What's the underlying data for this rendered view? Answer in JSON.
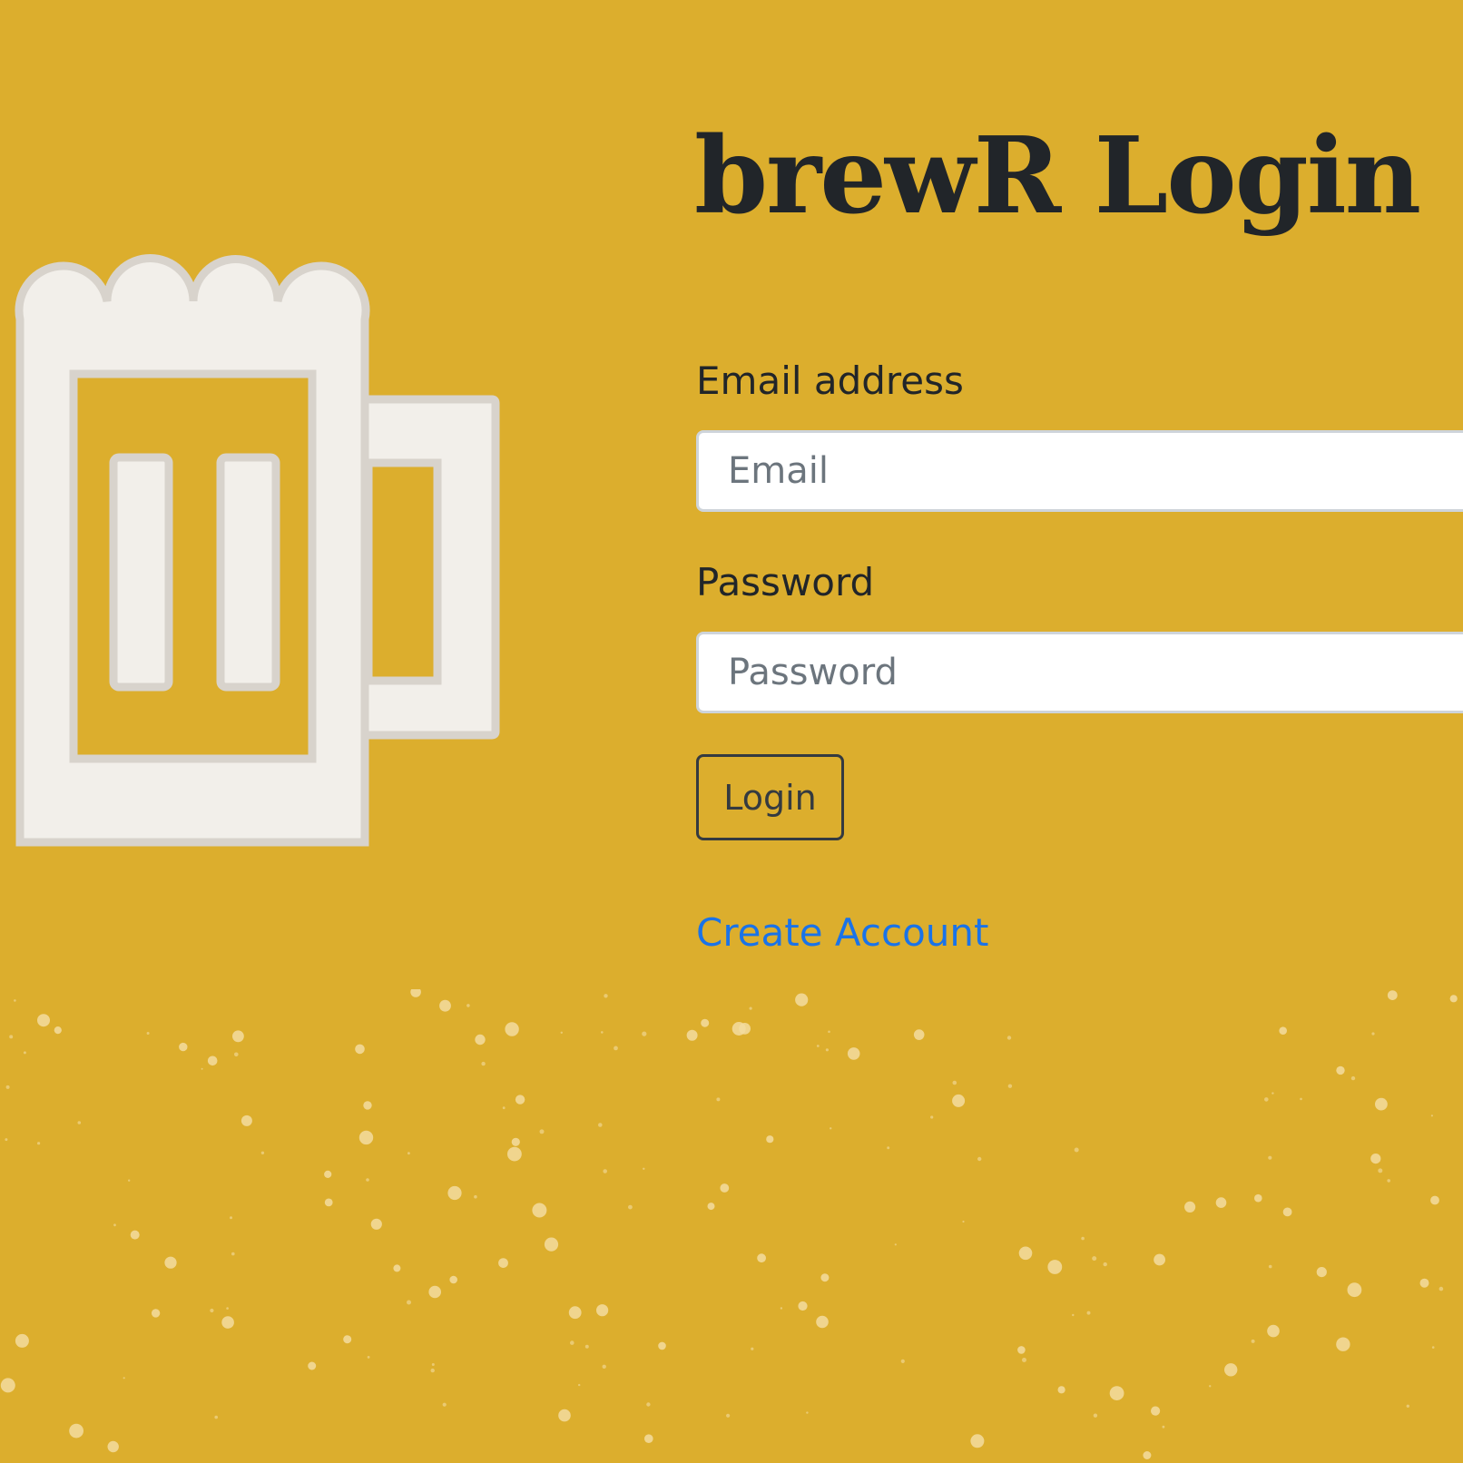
{
  "title": "brewR Login",
  "logo": {
    "icon": "beer-mug-icon"
  },
  "form": {
    "email_label": "Email address",
    "email_placeholder": "Email",
    "email_value": "",
    "password_label": "Password",
    "password_placeholder": "Password",
    "password_value": "",
    "login_button": "Login",
    "create_account_link": "Create Account"
  },
  "colors": {
    "background": "#dcae2d",
    "text": "#212529",
    "link": "#1a73e8",
    "foam": "#f2efea",
    "bubble": "#f3dca0"
  }
}
